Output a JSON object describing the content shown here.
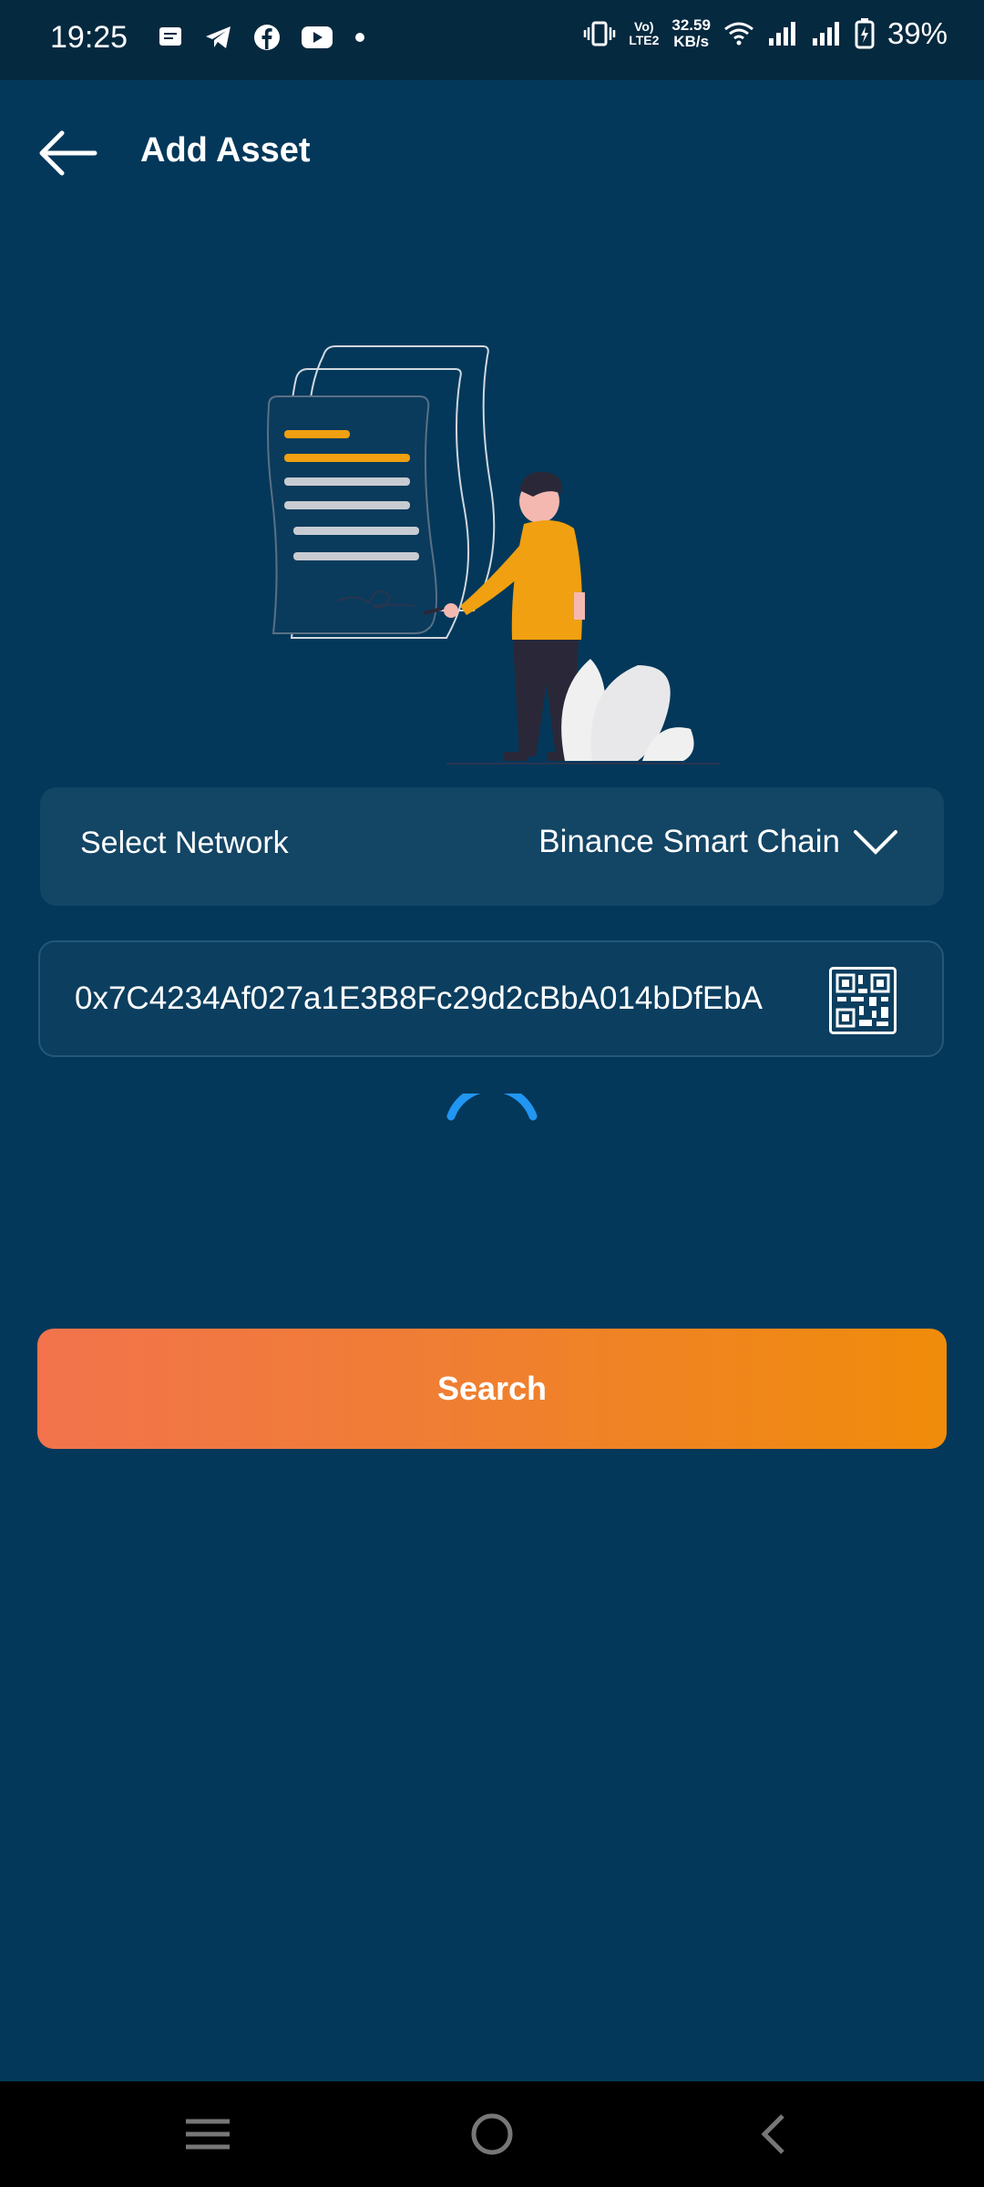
{
  "status_bar": {
    "time": "19:25",
    "left_icons": [
      "message-icon",
      "telegram-icon",
      "facebook-icon",
      "youtube-icon",
      "dot-icon"
    ],
    "volte": "Vo)\nLTE2",
    "net_speed_value": "32.59",
    "net_speed_unit": "KB/s",
    "battery": "39%"
  },
  "header": {
    "title": "Add Asset",
    "back_icon": "arrow-left-icon"
  },
  "network": {
    "label": "Select Network",
    "value": "Binance Smart Chain",
    "icon": "chevron-down-icon"
  },
  "address": {
    "value": "0x7C4234Af027a1E3B8Fc29d2cBbA014bDfEbA",
    "scan_icon": "qr-code-icon"
  },
  "loading": {
    "icon": "spinner-icon",
    "color": "#2196f3"
  },
  "search_button": {
    "label": "Search"
  },
  "colors": {
    "background": "#03385a",
    "card": "#134565",
    "accent_orange": "#f08c0a",
    "accent_coral": "#f2734c"
  },
  "nav_bar": {
    "items": [
      "menu-icon",
      "home-icon",
      "back-icon"
    ]
  }
}
